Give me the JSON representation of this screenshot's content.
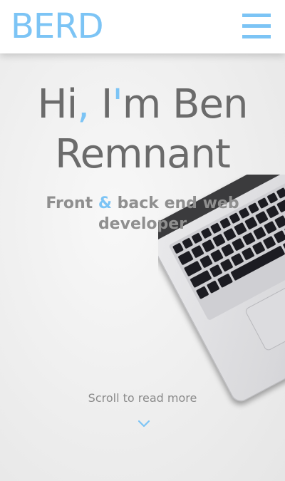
{
  "header": {
    "logo": "BERD",
    "menu_icon": "hamburger-menu-icon"
  },
  "hero": {
    "title_part1": "Hi",
    "title_comma": ",",
    "title_part2": " I",
    "title_apostrophe": "'",
    "title_part3": "m Ben",
    "title_line2": "Remnant",
    "subtitle_part1": "Front ",
    "subtitle_amp": "&",
    "subtitle_part2": " back end web",
    "subtitle_line2": "developer"
  },
  "scroll": {
    "label": "Scroll to read more",
    "icon": "chevron-down-icon"
  },
  "colors": {
    "accent": "#7cc4f5",
    "text": "#6b6b6b",
    "subtext": "#8f8f8f",
    "header_bg": "#ffffff"
  }
}
